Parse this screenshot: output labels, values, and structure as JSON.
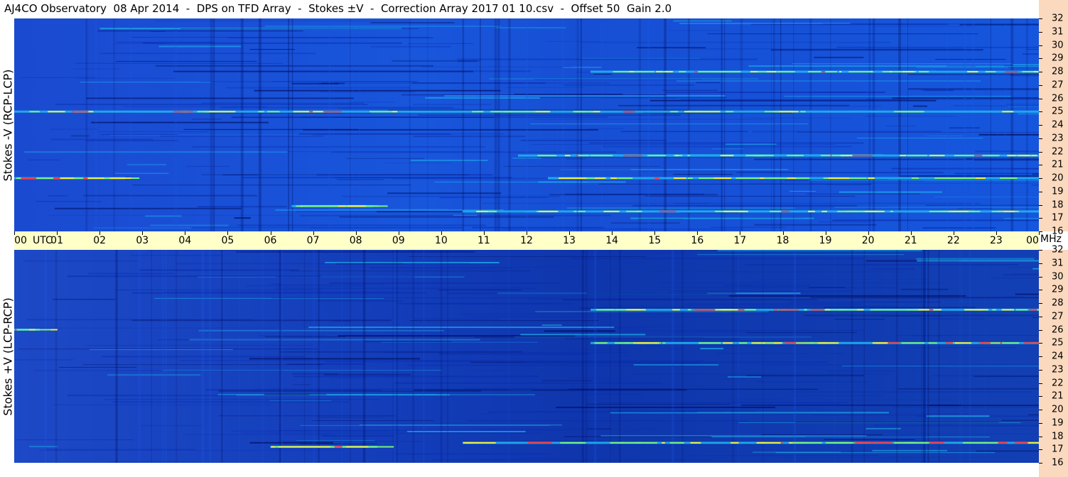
{
  "title": "AJ4CO Observatory  08 Apr 2014  -  DPS on TFD Array  -  Stokes ±V  -  Correction Array 2017 01 10.csv  -  Offset 50  Gain 2.0",
  "chart_data": [
    {
      "type": "heatmap",
      "ylabel": "Stokes -V (RCP-LCP)",
      "x_unit": "UTC",
      "y_unit": "MHz",
      "xlim": [
        0,
        24
      ],
      "ylim": [
        16,
        32
      ],
      "x_ticks": [
        "00",
        "01",
        "02",
        "03",
        "04",
        "05",
        "06",
        "07",
        "08",
        "09",
        "10",
        "11",
        "12",
        "13",
        "14",
        "15",
        "16",
        "17",
        "18",
        "19",
        "20",
        "21",
        "22",
        "23",
        "00"
      ],
      "y_ticks": [
        "16",
        "17",
        "18",
        "19",
        "20",
        "21",
        "22",
        "23",
        "24",
        "25",
        "26",
        "27",
        "28",
        "29",
        "30",
        "31",
        "32"
      ],
      "colormap": [
        "#000a5a",
        "#0a2fb0",
        "#1a5ae6",
        "#21b9f0",
        "#7af27a",
        "#f2f03a",
        "#ff3a3a"
      ],
      "bright_bands": [
        {
          "freq": 25.0,
          "x_start": 0.0,
          "x_end": 24.0
        },
        {
          "freq": 20.0,
          "x_start": 0.0,
          "x_end": 2.6
        },
        {
          "freq": 20.0,
          "x_start": 12.5,
          "x_end": 24.0
        },
        {
          "freq": 21.7,
          "x_start": 11.8,
          "x_end": 24.0
        },
        {
          "freq": 17.9,
          "x_start": 6.5,
          "x_end": 8.4
        },
        {
          "freq": 17.5,
          "x_start": 10.5,
          "x_end": 24.0
        },
        {
          "freq": 28.0,
          "x_start": 13.5,
          "x_end": 24.0
        }
      ]
    },
    {
      "type": "heatmap",
      "ylabel": "Stokes +V (LCP-RCP)",
      "x_unit": "UTC",
      "y_unit": "MHz",
      "xlim": [
        0,
        24
      ],
      "ylim": [
        16,
        32
      ],
      "x_ticks": [
        "00",
        "01",
        "02",
        "03",
        "04",
        "05",
        "06",
        "07",
        "08",
        "09",
        "10",
        "11",
        "12",
        "13",
        "14",
        "15",
        "16",
        "17",
        "18",
        "19",
        "20",
        "21",
        "22",
        "23",
        "00"
      ],
      "y_ticks": [
        "16",
        "17",
        "18",
        "19",
        "20",
        "21",
        "22",
        "23",
        "24",
        "25",
        "26",
        "27",
        "28",
        "29",
        "30",
        "31",
        "32"
      ],
      "colormap": [
        "#000a5a",
        "#0a2fb0",
        "#1a5ae6",
        "#21b9f0",
        "#7af27a",
        "#f2f03a",
        "#ff3a3a"
      ],
      "bright_bands": [
        {
          "freq": 25.0,
          "x_start": 13.5,
          "x_end": 24.0
        },
        {
          "freq": 26.0,
          "x_start": 0.0,
          "x_end": 0.6
        },
        {
          "freq": 27.5,
          "x_start": 13.5,
          "x_end": 24.0
        },
        {
          "freq": 17.2,
          "x_start": 6.0,
          "x_end": 8.5
        },
        {
          "freq": 17.5,
          "x_start": 10.5,
          "x_end": 24.0
        }
      ]
    }
  ]
}
